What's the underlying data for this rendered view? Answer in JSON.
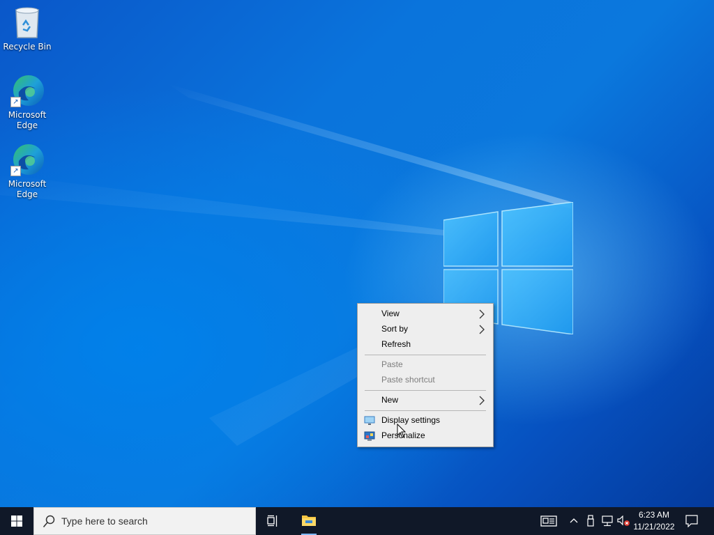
{
  "desktop": {
    "icons": [
      {
        "label": "Recycle Bin",
        "icon": "recycle-bin-icon"
      },
      {
        "label": "Microsoft\nEdge",
        "icon": "edge-icon"
      },
      {
        "label": "Microsoft\nEdge",
        "icon": "edge-icon"
      }
    ]
  },
  "context_menu": {
    "items": [
      {
        "label": "View",
        "submenu": true,
        "enabled": true
      },
      {
        "label": "Sort by",
        "submenu": true,
        "enabled": true
      },
      {
        "label": "Refresh",
        "enabled": true
      },
      {
        "label": "Paste",
        "enabled": false
      },
      {
        "label": "Paste shortcut",
        "enabled": false
      },
      {
        "label": "New",
        "submenu": true,
        "enabled": true
      },
      {
        "label": "Display settings",
        "icon": "display-icon",
        "enabled": true
      },
      {
        "label": "Personalize",
        "icon": "personalize-icon",
        "enabled": true
      }
    ]
  },
  "taskbar": {
    "search_placeholder": "Type here to search",
    "pinned": [
      "task-view-icon",
      "file-explorer-icon"
    ],
    "tray_icons": [
      "news-icon",
      "chevron-up-icon",
      "usb-icon",
      "network-icon",
      "volume-muted-icon"
    ],
    "time": "6:23 AM",
    "date": "11/21/2022",
    "notification_icon": "action-center-icon"
  },
  "colors": {
    "wallpaper_blue": "#0a74dc",
    "taskbar": "#101828",
    "menu_bg": "#eeeeee",
    "disabled_text": "#7d7d7d"
  }
}
